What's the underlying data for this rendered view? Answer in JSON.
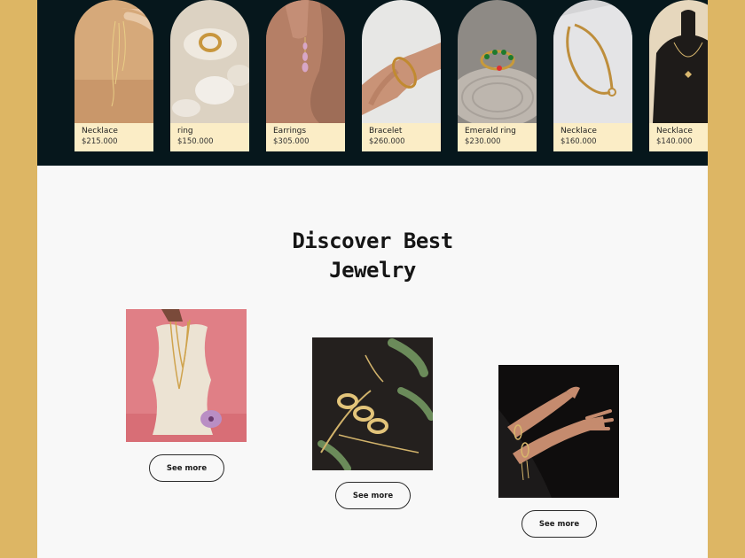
{
  "products": [
    {
      "name": "Necklace",
      "price": "$215.000",
      "icon": "necklace-in-hand-photo"
    },
    {
      "name": "ring",
      "price": "$150.000",
      "icon": "ring-on-stones-photo"
    },
    {
      "name": "Earrings",
      "price": "$305.000",
      "icon": "earrings-photo"
    },
    {
      "name": "Bracelet",
      "price": "$260.000",
      "icon": "bracelet-on-wrist-photo"
    },
    {
      "name": "Emerald ring",
      "price": "$230.000",
      "icon": "emerald-ring-photo"
    },
    {
      "name": "Necklace",
      "price": "$160.000",
      "icon": "chain-necklace-photo"
    },
    {
      "name": "Necklace",
      "price": "$140.000",
      "icon": "butterfly-necklace-photo"
    }
  ],
  "discover": {
    "title_line1": "Discover Best",
    "title_line2": "Jewelry"
  },
  "features": [
    {
      "button_label": "See more",
      "icon": "necklaces-on-pink-photo"
    },
    {
      "button_label": "See more",
      "icon": "chains-with-leaves-photo"
    },
    {
      "button_label": "See more",
      "icon": "hands-with-rings-photo"
    }
  ],
  "colors": {
    "background": "#DDB664",
    "strip": "#06171C",
    "card_label": "#FBEDC6",
    "page": "#F8F8F8"
  }
}
